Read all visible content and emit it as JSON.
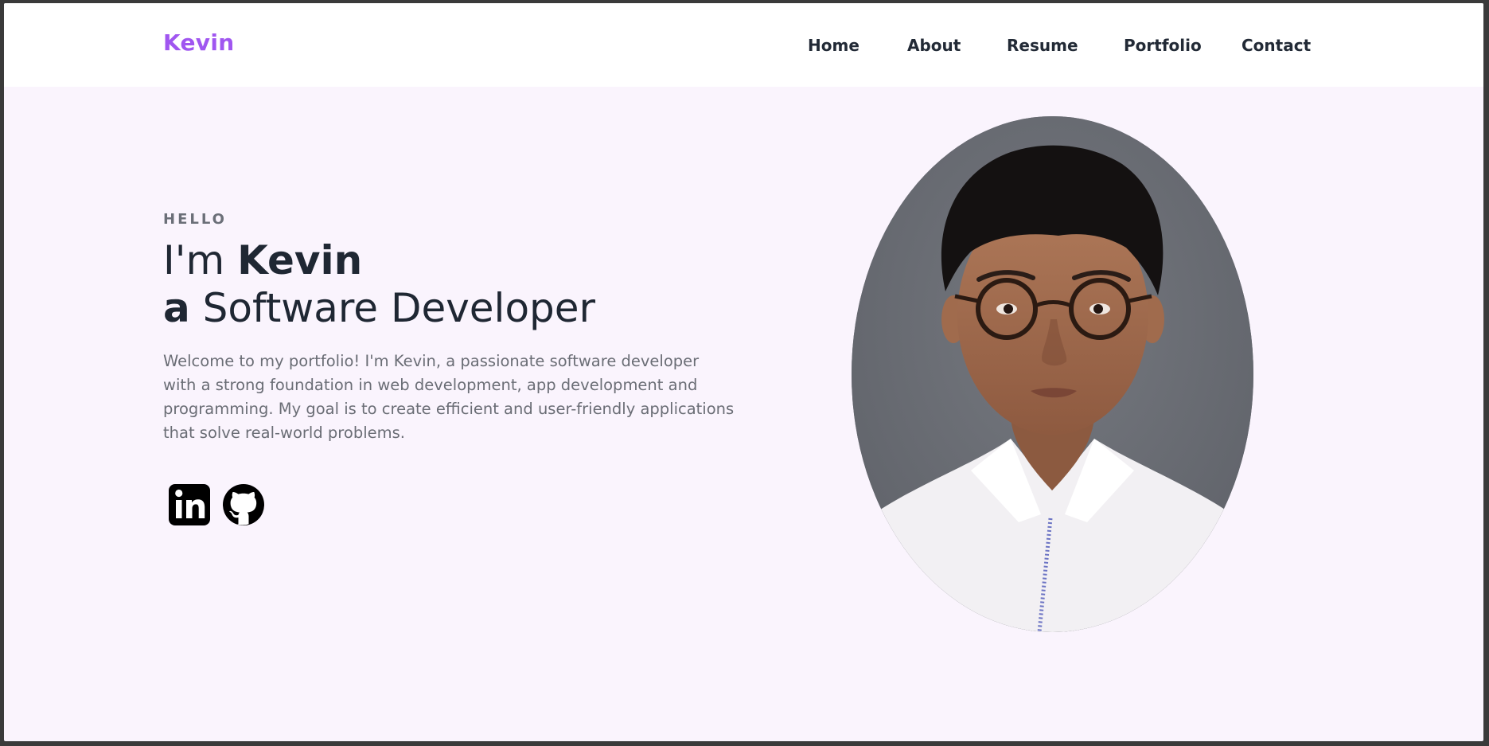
{
  "nav": {
    "brand": "Kevin",
    "items": [
      {
        "label": "Home"
      },
      {
        "label": "About"
      },
      {
        "label": "Resume"
      },
      {
        "label": "Portfolio"
      },
      {
        "label": "Contact"
      }
    ]
  },
  "hero": {
    "greeting": "HELLO",
    "line1_prefix": "I'm ",
    "line1_name": "Kevin",
    "line2_article": "a",
    "line2_role": " Software Developer",
    "intro": "Welcome to my portfolio! I'm Kevin, a passionate software developer with a strong foundation in web development, app development and programming. My goal is to create efficient and user-friendly applications that solve real-world problems."
  },
  "socials": [
    {
      "icon": "linkedin-icon"
    },
    {
      "icon": "github-icon"
    }
  ],
  "colors": {
    "brand": "#a056f0",
    "hero_bg": "#faf4fd",
    "nav_text": "#222a36",
    "heading": "#1f2733",
    "body_text": "#6a6d75"
  }
}
